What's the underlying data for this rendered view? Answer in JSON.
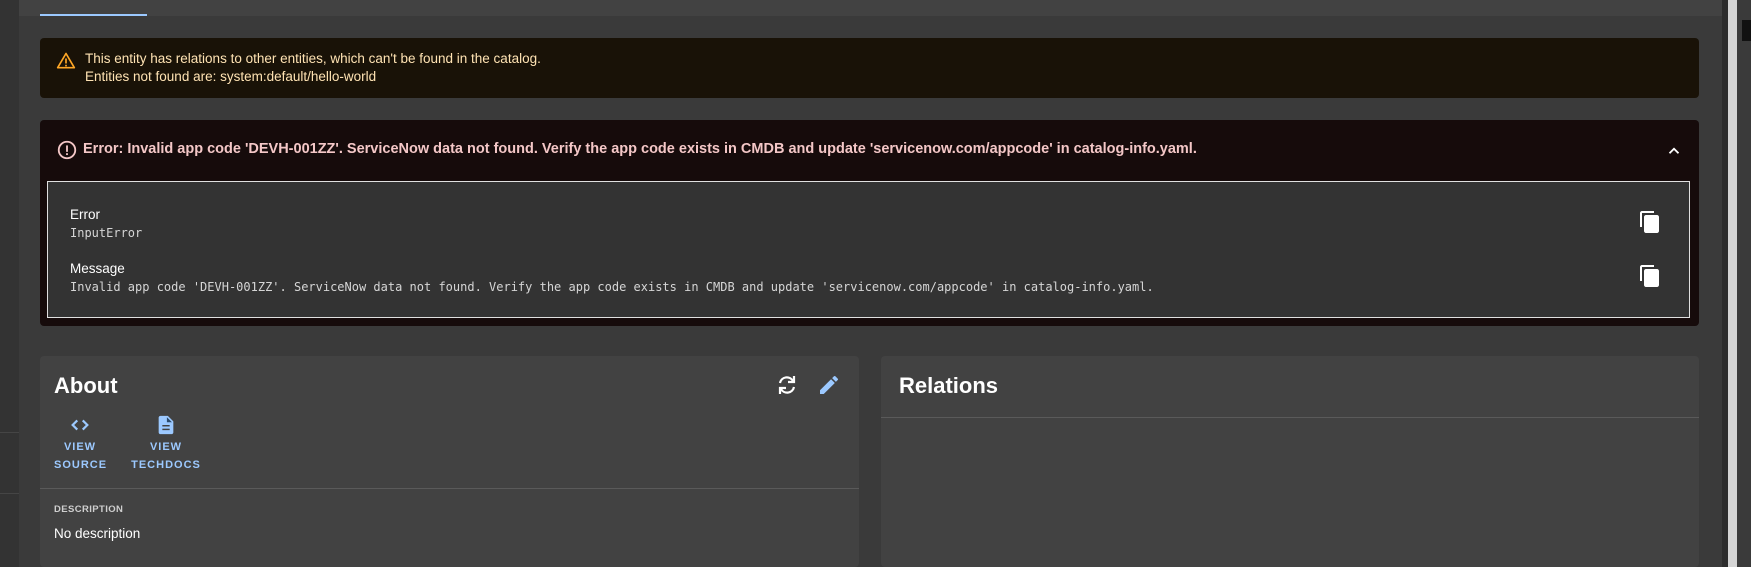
{
  "warning": {
    "line1": "This entity has relations to other entities, which can't be found in the catalog.",
    "line2": "Entities not found are: system:default/hello-world",
    "icon": "warning-icon"
  },
  "error": {
    "title": "Error: Invalid app code 'DEVH-001ZZ'. ServiceNow data not found. Verify the app code exists in CMDB and update 'servicenow.com/appcode' in catalog-info.yaml.",
    "fields": [
      {
        "label": "Error",
        "value": "InputError"
      },
      {
        "label": "Message",
        "value": "Invalid app code 'DEVH-001ZZ'. ServiceNow data not found. Verify the app code exists in CMDB and update 'servicenow.com/appcode' in catalog-info.yaml."
      }
    ]
  },
  "about": {
    "title": "About",
    "links": [
      {
        "line1": "VIEW",
        "line2": "SOURCE",
        "icon": "code-icon"
      },
      {
        "line1": "VIEW",
        "line2": "TECHDOCS",
        "icon": "document-icon"
      }
    ],
    "description_label": "DESCRIPTION",
    "description": "No description"
  },
  "relations": {
    "title": "Relations"
  },
  "colors": {
    "accent": "#9cc9ff",
    "warning_bg": "#191207",
    "warning_text": "#ffe3b3",
    "error_bg": "#160b0b",
    "error_text": "#f4c7c7",
    "card_bg": "#424242"
  }
}
